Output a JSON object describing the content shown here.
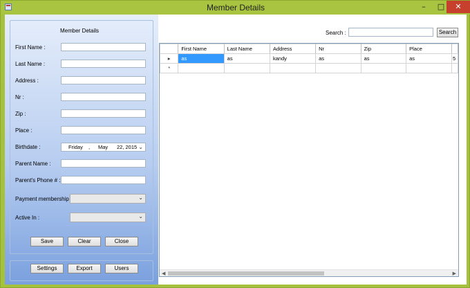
{
  "window": {
    "title": "Member Details"
  },
  "form": {
    "group_title": "Member Details",
    "fields": {
      "first_name_label": "First Name :",
      "last_name_label": "Last Name :",
      "address_label": "Address :",
      "nr_label": "Nr :",
      "zip_label": "Zip :",
      "place_label": "Place :",
      "birthdate_label": "Birthdate :",
      "parent_name_label": "Parent Name :",
      "parent_phone_label": "Parent's Phone # :",
      "payment_label": "Payment membership :",
      "active_label": "Active In :"
    },
    "birthdate": {
      "weekday": "Friday",
      "sep": ",",
      "month": "May",
      "day_year": "22, 2015"
    },
    "buttons": {
      "save": "Save",
      "clear": "Clear",
      "close": "Close"
    }
  },
  "bottom_buttons": {
    "settings": "Settings",
    "export": "Export",
    "users": "Users"
  },
  "search": {
    "label": "Search :",
    "button": "Search",
    "value": ""
  },
  "grid": {
    "columns": [
      "First Name",
      "Last Name",
      "Address",
      "Nr",
      "Zip",
      "Place"
    ],
    "rows": [
      [
        "as",
        "as",
        "kandy",
        "as",
        "as",
        "as",
        "5"
      ]
    ],
    "row_markers": [
      "▸",
      "*"
    ]
  }
}
